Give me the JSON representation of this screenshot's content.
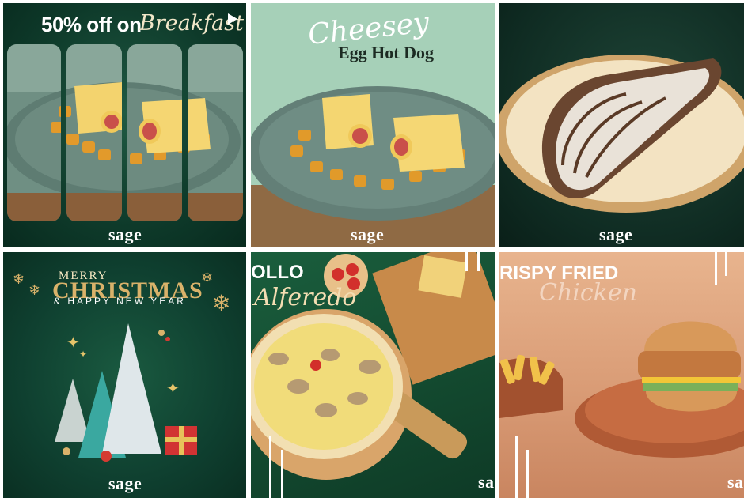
{
  "brand": "sage",
  "tiles": [
    {
      "id": "breakfast-promo",
      "headline": "50% off on",
      "script": "Breakfast"
    },
    {
      "id": "egg-hot-dog",
      "script": "Cheesey",
      "title": "Egg Hot Dog"
    },
    {
      "id": "crepe"
    },
    {
      "id": "christmas",
      "line1": "MERRY",
      "line2": "CHRISTMAS",
      "line3": "& HAPPY NEW YEAR"
    },
    {
      "id": "pollo-alfredo",
      "headline": "OLLO",
      "script": "Alferedo"
    },
    {
      "id": "crispy-chicken",
      "headline": "RISPY FRIED",
      "script": "Chicken"
    }
  ],
  "colors": {
    "gold": "#d9b26a",
    "dark_green": "#0e3a2a",
    "mint": "#a9d3bb",
    "peach": "#e8b48e"
  }
}
